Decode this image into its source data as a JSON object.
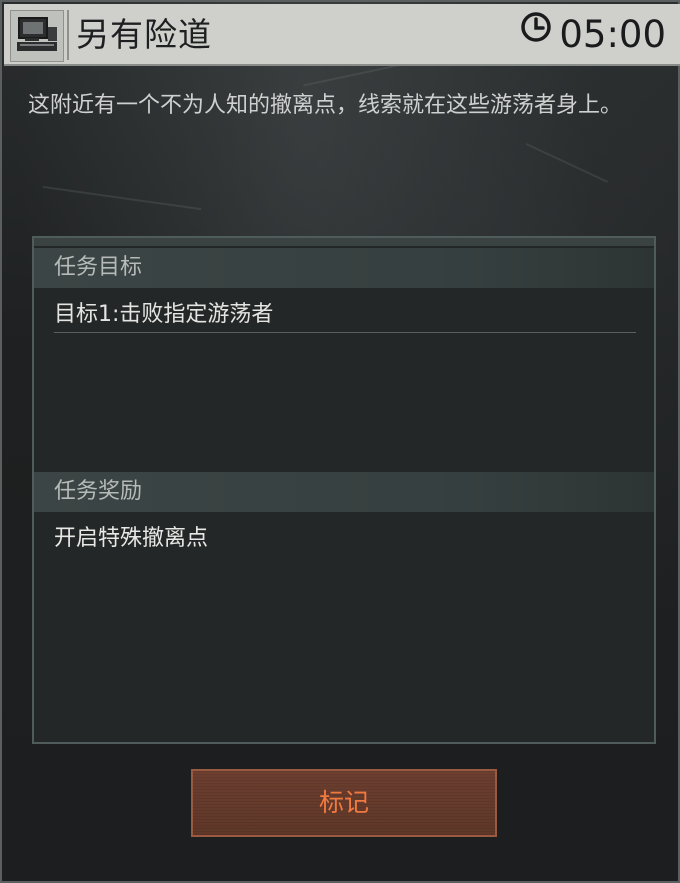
{
  "header": {
    "title": "另有险道",
    "timer": "05:00",
    "icon": "terminal-icon",
    "clock_icon": "clock-icon"
  },
  "description": "这附近有一个不为人知的撤离点，线索就在这些游荡者身上。",
  "panel": {
    "objectives_header": "任务目标",
    "objectives": [
      {
        "label": "目标1:击败指定游荡者"
      }
    ],
    "rewards_header": "任务奖励",
    "rewards": [
      {
        "label": "开启特殊撤离点"
      }
    ]
  },
  "button": {
    "label": "标记",
    "accent_color": "#f0793f"
  }
}
